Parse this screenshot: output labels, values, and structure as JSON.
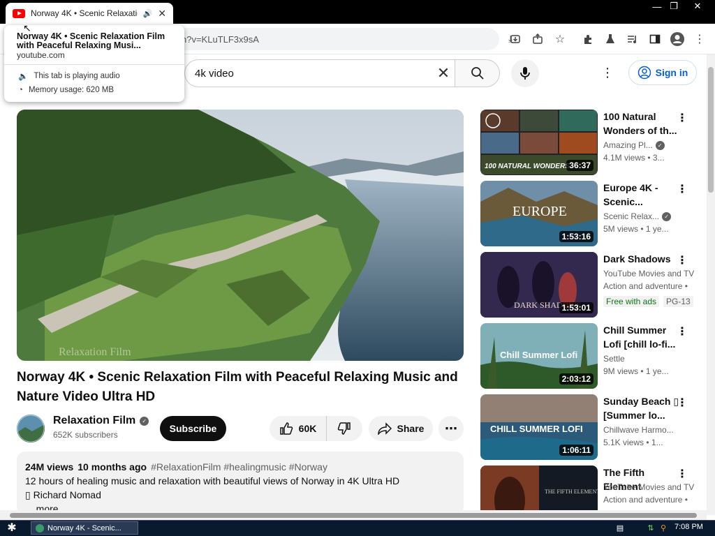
{
  "browser": {
    "tab_title": "Norway 4K • Scenic Relaxation",
    "url": "youtube.com/watch?v=KLuTLF3x9sA",
    "url_visible": "n?v=KLuTLF3x9sA",
    "hover_card": {
      "title": "Norway 4K • Scenic Relaxation Film with Peaceful Relaxing Musi...",
      "domain": "youtube.com",
      "audio": "This tab is playing audio",
      "memory": "Memory usage: 620 MB"
    }
  },
  "youtube": {
    "search_value": "4k video",
    "sign_in": "Sign in"
  },
  "video": {
    "title": "Norway 4K • Scenic Relaxation Film with Peaceful Relaxing Music and Nature Video Ultra HD",
    "channel": "Relaxation Film",
    "subscribers": "652K subscribers",
    "subscribe": "Subscribe",
    "likes": "60K",
    "share": "Share",
    "views": "24M views",
    "age": "10 months ago",
    "tags": "#RelaxationFilm #healingmusic #Norway",
    "desc_line1": "12 hours of healing music and relaxation with beautiful views of Norway in 4K Ultra HD",
    "desc_line2": "▯ Richard Nomad",
    "more": "...more",
    "watermark": "Relaxation Film"
  },
  "recs": [
    {
      "title": "100 Natural Wonders of th...",
      "channel": "Amazing Pl...",
      "meta": "4.1M views  •  3...",
      "duration": "36:37",
      "thumb_text": "100 NATURAL WONDERS"
    },
    {
      "title": "Europe 4K - Scenic...",
      "channel": "Scenic Relax...",
      "meta": "5M views  •  1 ye...",
      "duration": "1:53:16",
      "thumb_text": "EUROPE"
    },
    {
      "title": "Dark Shadows",
      "channel": "YouTube Movies and TV",
      "meta": "Action and adventure •",
      "badge1": "Free with ads",
      "badge2": "PG-13",
      "duration": "1:53:01",
      "thumb_text": "DARK SHADOWS"
    },
    {
      "title": "Chill Summer Lofi [chill lo-fi...",
      "channel": "Settle",
      "meta": "9M views  •  1 ye...",
      "duration": "2:03:12",
      "thumb_text": "Chill Summer Lofi"
    },
    {
      "title": "Sunday Beach ▯ [Summer lo...",
      "channel": "Chillwave Harmo...",
      "meta": "5.1K views  •  1...",
      "duration": "1:06:11",
      "thumb_text": "CHILL SUMMER LOFI"
    },
    {
      "title": "The Fifth Element",
      "channel": "YouTube Movies and TV",
      "meta": "Action and adventure •",
      "thumb_text": "THE FIFTH ELEMENT"
    }
  ],
  "taskbar": {
    "task_label": "Norway 4K - Scenic...",
    "clock": "7:08 PM"
  }
}
